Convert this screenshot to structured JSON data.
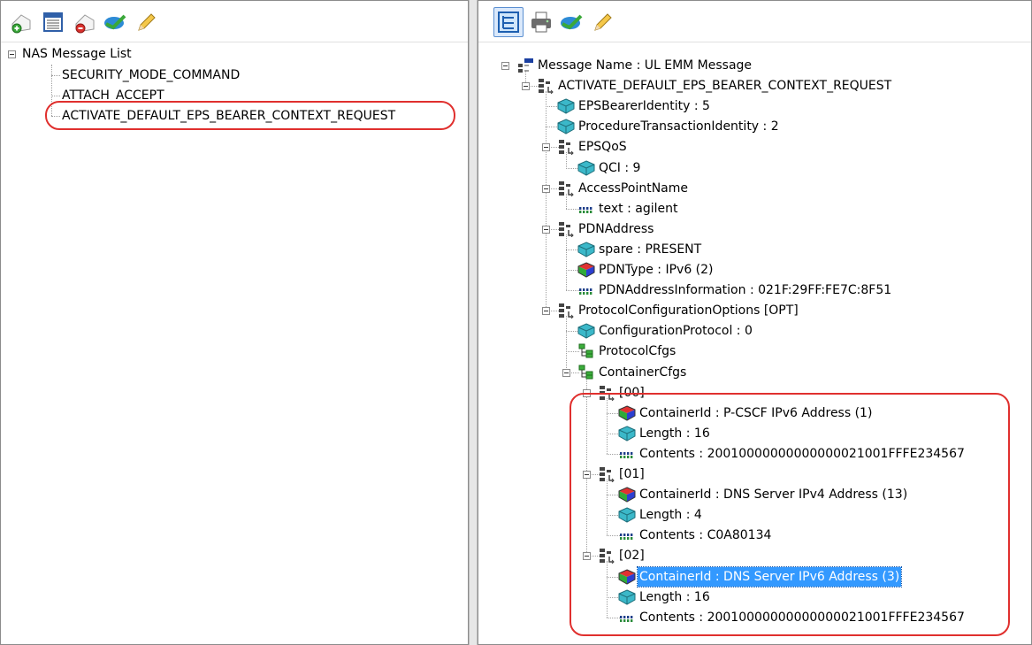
{
  "left_tree": {
    "root_label": "NAS Message List",
    "items": [
      {
        "label": "SECURITY_MODE_COMMAND"
      },
      {
        "label": "ATTACH_ACCEPT"
      },
      {
        "label": "ACTIVATE_DEFAULT_EPS_BEARER_CONTEXT_REQUEST"
      }
    ]
  },
  "left_toolbar": {
    "icons": [
      "add-message-icon",
      "table-icon",
      "remove-message-icon",
      "validate-icon",
      "edit-pencil-icon"
    ]
  },
  "right_toolbar": {
    "icons": [
      "tree-view-icon",
      "print-icon",
      "validate-icon",
      "edit-pencil-icon"
    ]
  },
  "right_tree": {
    "nodes": [
      {
        "label": "Message Name : UL EMM Message",
        "icon": "pdu-icon"
      },
      {
        "label": "ACTIVATE_DEFAULT_EPS_BEARER_CONTEXT_REQUEST",
        "icon": "sequence-icon"
      },
      {
        "label": "EPSBearerIdentity : 5",
        "icon": "integer-gem-icon"
      },
      {
        "label": "ProcedureTransactionIdentity : 2",
        "icon": "integer-gem-icon"
      },
      {
        "label": "EPSQoS",
        "icon": "sequence-icon"
      },
      {
        "label": "QCI : 9",
        "icon": "integer-gem-icon"
      },
      {
        "label": "AccessPointName",
        "icon": "sequence-icon"
      },
      {
        "label": "text : agilent",
        "icon": "octet-string-icon"
      },
      {
        "label": "PDNAddress",
        "icon": "sequence-icon"
      },
      {
        "label": "spare : PRESENT",
        "icon": "integer-gem-icon"
      },
      {
        "label": "PDNType : IPv6 (2)",
        "icon": "enumerated-gem-icon"
      },
      {
        "label": "PDNAddressInformation : 021F:29FF:FE7C:8F51",
        "icon": "octet-string-icon"
      },
      {
        "label": "ProtocolConfigurationOptions [OPT]",
        "icon": "sequence-icon"
      },
      {
        "label": "ConfigurationProtocol : 0",
        "icon": "integer-gem-icon"
      },
      {
        "label": "ProtocolCfgs",
        "icon": "list-icon"
      },
      {
        "label": "ContainerCfgs",
        "icon": "list-icon"
      },
      {
        "label": "[00]",
        "icon": "sequence-icon"
      },
      {
        "label": "ContainerId : P-CSCF IPv6 Address (1)",
        "icon": "enumerated-gem-icon"
      },
      {
        "label": "Length : 16",
        "icon": "integer-gem-icon"
      },
      {
        "label": "Contents : 20010000000000000021001FFFE234567",
        "icon": "octet-string-icon"
      },
      {
        "label": "[01]",
        "icon": "sequence-icon"
      },
      {
        "label": "ContainerId : DNS Server IPv4 Address (13)",
        "icon": "enumerated-gem-icon"
      },
      {
        "label": "Length : 4",
        "icon": "integer-gem-icon"
      },
      {
        "label": "Contents : C0A80134",
        "icon": "octet-string-icon"
      },
      {
        "label": "[02]",
        "icon": "sequence-icon"
      },
      {
        "label": "ContainerId : DNS Server IPv6 Address (3)",
        "icon": "enumerated-gem-icon",
        "selected": true
      },
      {
        "label": "Length : 16",
        "icon": "integer-gem-icon"
      },
      {
        "label": "Contents : 20010000000000000021001FFFE234567",
        "icon": "octet-string-icon"
      }
    ]
  },
  "colors": {
    "selection": "#3399ff",
    "annotation": "#e0302e",
    "gem_cyan": "#3bb8c9"
  }
}
